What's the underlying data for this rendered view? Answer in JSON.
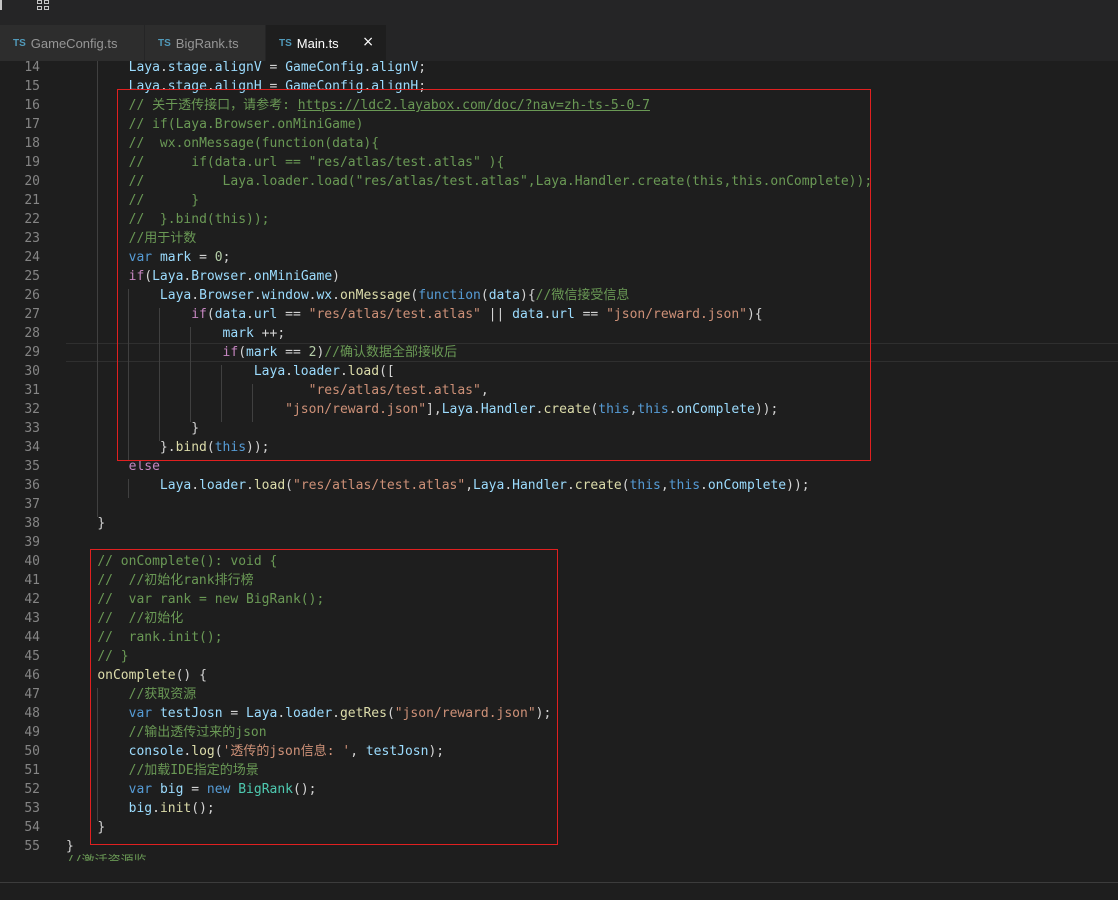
{
  "tabs": [
    {
      "badge": "TS",
      "name": "GameConfig.ts"
    },
    {
      "badge": "TS",
      "name": "BigRank.ts"
    },
    {
      "badge": "TS",
      "name": "Main.ts",
      "close": "×"
    }
  ],
  "lines": [
    {
      "n": "14",
      "t": [
        [
          "        ",
          ""
        ],
        [
          "Laya",
          "vr"
        ],
        [
          ".",
          ""
        ],
        [
          "stage",
          "vr"
        ],
        [
          ".",
          ""
        ],
        [
          "alignV",
          "vr"
        ],
        [
          " = ",
          ""
        ],
        [
          "GameConfig",
          "vr"
        ],
        [
          ".",
          ""
        ],
        [
          "alignV",
          "vr"
        ],
        [
          ";",
          ""
        ]
      ]
    },
    {
      "n": "15",
      "t": [
        [
          "        ",
          ""
        ],
        [
          "Laya",
          "vr"
        ],
        [
          ".",
          ""
        ],
        [
          "stage",
          "vr"
        ],
        [
          ".",
          ""
        ],
        [
          "alignH",
          "vr"
        ],
        [
          " = ",
          ""
        ],
        [
          "GameConfig",
          "vr"
        ],
        [
          ".",
          ""
        ],
        [
          "alignH",
          "vr"
        ],
        [
          ";",
          ""
        ]
      ]
    },
    {
      "n": "16",
      "t": [
        [
          "        ",
          ""
        ],
        [
          "// 关于透传接口，请参考: ",
          "com"
        ],
        [
          "https://ldc2.layabox.com/doc/?nav=zh-ts-5-0-7",
          "link"
        ]
      ]
    },
    {
      "n": "17",
      "t": [
        [
          "        ",
          ""
        ],
        [
          "// if(Laya.Browser.onMiniGame)",
          "com"
        ]
      ]
    },
    {
      "n": "18",
      "t": [
        [
          "        ",
          ""
        ],
        [
          "//  wx.onMessage(function(data){",
          "com"
        ]
      ]
    },
    {
      "n": "19",
      "t": [
        [
          "        ",
          ""
        ],
        [
          "//      if(data.url == \"res/atlas/test.atlas\" ){",
          "com"
        ]
      ]
    },
    {
      "n": "20",
      "t": [
        [
          "        ",
          ""
        ],
        [
          "//          Laya.loader.load(\"res/atlas/test.atlas\",Laya.Handler.create(this,this.onComplete));",
          "com"
        ]
      ]
    },
    {
      "n": "21",
      "t": [
        [
          "        ",
          ""
        ],
        [
          "//      }",
          "com"
        ]
      ]
    },
    {
      "n": "22",
      "t": [
        [
          "        ",
          ""
        ],
        [
          "//  }.bind(this));",
          "com"
        ]
      ]
    },
    {
      "n": "23",
      "t": [
        [
          "        ",
          ""
        ],
        [
          "//用于计数",
          "com"
        ]
      ]
    },
    {
      "n": "24",
      "t": [
        [
          "        ",
          ""
        ],
        [
          "var",
          "kw"
        ],
        [
          " ",
          ""
        ],
        [
          "mark",
          "vr"
        ],
        [
          " = ",
          ""
        ],
        [
          "0",
          "num"
        ],
        [
          ";",
          ""
        ]
      ]
    },
    {
      "n": "25",
      "t": [
        [
          "        ",
          ""
        ],
        [
          "if",
          "ctl"
        ],
        [
          "(",
          ""
        ],
        [
          "Laya",
          "vr"
        ],
        [
          ".",
          ""
        ],
        [
          "Browser",
          "vr"
        ],
        [
          ".",
          ""
        ],
        [
          "onMiniGame",
          "vr"
        ],
        [
          ")",
          ""
        ]
      ]
    },
    {
      "n": "26",
      "t": [
        [
          "            ",
          ""
        ],
        [
          "Laya",
          "vr"
        ],
        [
          ".",
          ""
        ],
        [
          "Browser",
          "vr"
        ],
        [
          ".",
          ""
        ],
        [
          "window",
          "vr"
        ],
        [
          ".",
          ""
        ],
        [
          "wx",
          "vr"
        ],
        [
          ".",
          ""
        ],
        [
          "onMessage",
          "fn"
        ],
        [
          "(",
          ""
        ],
        [
          "function",
          "kw"
        ],
        [
          "(",
          ""
        ],
        [
          "data",
          "vr"
        ],
        [
          "){",
          ""
        ],
        [
          "//微信接受信息",
          "com"
        ]
      ]
    },
    {
      "n": "27",
      "t": [
        [
          "                ",
          ""
        ],
        [
          "if",
          "ctl"
        ],
        [
          "(",
          ""
        ],
        [
          "data",
          "vr"
        ],
        [
          ".",
          ""
        ],
        [
          "url",
          "vr"
        ],
        [
          " == ",
          ""
        ],
        [
          "\"res/atlas/test.atlas\"",
          "str"
        ],
        [
          " || ",
          ""
        ],
        [
          "data",
          "vr"
        ],
        [
          ".",
          ""
        ],
        [
          "url",
          "vr"
        ],
        [
          " == ",
          ""
        ],
        [
          "\"json/reward.json\"",
          "str"
        ],
        [
          "){",
          ""
        ]
      ]
    },
    {
      "n": "28",
      "t": [
        [
          "                    ",
          ""
        ],
        [
          "mark",
          "vr"
        ],
        [
          " ++;",
          ""
        ]
      ]
    },
    {
      "n": "29",
      "t": [
        [
          "                    ",
          ""
        ],
        [
          "if",
          "ctl"
        ],
        [
          "(",
          ""
        ],
        [
          "mark",
          "vr"
        ],
        [
          " == ",
          ""
        ],
        [
          "2",
          "num"
        ],
        [
          ")",
          ""
        ],
        [
          "//确认数据全部接收后",
          "com"
        ]
      ]
    },
    {
      "n": "30",
      "t": [
        [
          "                        ",
          ""
        ],
        [
          "Laya",
          "vr"
        ],
        [
          ".",
          ""
        ],
        [
          "loader",
          "vr"
        ],
        [
          ".",
          ""
        ],
        [
          "load",
          "fn"
        ],
        [
          "([",
          ""
        ]
      ]
    },
    {
      "n": "31",
      "t": [
        [
          "                               ",
          ""
        ],
        [
          "\"res/atlas/test.atlas\"",
          "str"
        ],
        [
          ",",
          ""
        ]
      ]
    },
    {
      "n": "32",
      "t": [
        [
          "                            ",
          ""
        ],
        [
          "\"json/reward.json\"",
          "str"
        ],
        [
          "],",
          ""
        ],
        [
          "Laya",
          "vr"
        ],
        [
          ".",
          ""
        ],
        [
          "Handler",
          "vr"
        ],
        [
          ".",
          ""
        ],
        [
          "create",
          "fn"
        ],
        [
          "(",
          ""
        ],
        [
          "this",
          "kw"
        ],
        [
          ",",
          ""
        ],
        [
          "this",
          "kw"
        ],
        [
          ".",
          ""
        ],
        [
          "onComplete",
          "vr"
        ],
        [
          "));",
          ""
        ]
      ]
    },
    {
      "n": "33",
      "t": [
        [
          "                ",
          ""
        ],
        [
          "}",
          ""
        ]
      ]
    },
    {
      "n": "34",
      "t": [
        [
          "            ",
          ""
        ],
        [
          "}.",
          ""
        ],
        [
          "bind",
          "fn"
        ],
        [
          "(",
          ""
        ],
        [
          "this",
          "kw"
        ],
        [
          "));",
          ""
        ]
      ]
    },
    {
      "n": "35",
      "t": [
        [
          "        ",
          ""
        ],
        [
          "else",
          "ctl"
        ]
      ]
    },
    {
      "n": "36",
      "t": [
        [
          "            ",
          ""
        ],
        [
          "Laya",
          "vr"
        ],
        [
          ".",
          ""
        ],
        [
          "loader",
          "vr"
        ],
        [
          ".",
          ""
        ],
        [
          "load",
          "fn"
        ],
        [
          "(",
          ""
        ],
        [
          "\"res/atlas/test.atlas\"",
          "str"
        ],
        [
          ",",
          ""
        ],
        [
          "Laya",
          "vr"
        ],
        [
          ".",
          ""
        ],
        [
          "Handler",
          "vr"
        ],
        [
          ".",
          ""
        ],
        [
          "create",
          "fn"
        ],
        [
          "(",
          ""
        ],
        [
          "this",
          "kw"
        ],
        [
          ",",
          ""
        ],
        [
          "this",
          "kw"
        ],
        [
          ".",
          ""
        ],
        [
          "onComplete",
          "vr"
        ],
        [
          "));",
          ""
        ]
      ]
    },
    {
      "n": "37",
      "t": []
    },
    {
      "n": "38",
      "t": [
        [
          "    ",
          ""
        ],
        [
          "}",
          ""
        ]
      ]
    },
    {
      "n": "39",
      "t": []
    },
    {
      "n": "40",
      "t": [
        [
          "    ",
          ""
        ],
        [
          "// onComplete(): void {",
          "com"
        ]
      ]
    },
    {
      "n": "41",
      "t": [
        [
          "    ",
          ""
        ],
        [
          "//  //初始化rank排行榜",
          "com"
        ]
      ]
    },
    {
      "n": "42",
      "t": [
        [
          "    ",
          ""
        ],
        [
          "//  var rank = new BigRank();",
          "com"
        ]
      ]
    },
    {
      "n": "43",
      "t": [
        [
          "    ",
          ""
        ],
        [
          "//  //初始化",
          "com"
        ]
      ]
    },
    {
      "n": "44",
      "t": [
        [
          "    ",
          ""
        ],
        [
          "//  rank.init();",
          "com"
        ]
      ]
    },
    {
      "n": "45",
      "t": [
        [
          "    ",
          ""
        ],
        [
          "// }",
          "com"
        ]
      ]
    },
    {
      "n": "46",
      "t": [
        [
          "    ",
          ""
        ],
        [
          "onComplete",
          "fn"
        ],
        [
          "() {",
          ""
        ]
      ]
    },
    {
      "n": "47",
      "t": [
        [
          "        ",
          ""
        ],
        [
          "//获取资源",
          "com"
        ]
      ]
    },
    {
      "n": "48",
      "t": [
        [
          "        ",
          ""
        ],
        [
          "var",
          "kw"
        ],
        [
          " ",
          ""
        ],
        [
          "testJosn",
          "vr"
        ],
        [
          " = ",
          ""
        ],
        [
          "Laya",
          "vr"
        ],
        [
          ".",
          ""
        ],
        [
          "loader",
          "vr"
        ],
        [
          ".",
          ""
        ],
        [
          "getRes",
          "fn"
        ],
        [
          "(",
          ""
        ],
        [
          "\"json/reward.json\"",
          "str"
        ],
        [
          ");",
          ""
        ]
      ]
    },
    {
      "n": "49",
      "t": [
        [
          "        ",
          ""
        ],
        [
          "//输出透传过来的json",
          "com"
        ]
      ]
    },
    {
      "n": "50",
      "t": [
        [
          "        ",
          ""
        ],
        [
          "console",
          "vr"
        ],
        [
          ".",
          ""
        ],
        [
          "log",
          "fn"
        ],
        [
          "(",
          ""
        ],
        [
          "'透传的json信息: '",
          "str"
        ],
        [
          ", ",
          ""
        ],
        [
          "testJosn",
          "vr"
        ],
        [
          ");",
          ""
        ]
      ]
    },
    {
      "n": "51",
      "t": [
        [
          "        ",
          ""
        ],
        [
          "//加载IDE指定的场景",
          "com"
        ]
      ]
    },
    {
      "n": "52",
      "t": [
        [
          "        ",
          ""
        ],
        [
          "var",
          "kw"
        ],
        [
          " ",
          ""
        ],
        [
          "big",
          "vr"
        ],
        [
          " = ",
          ""
        ],
        [
          "new",
          "kw"
        ],
        [
          " ",
          ""
        ],
        [
          "BigRank",
          "cls"
        ],
        [
          "();",
          ""
        ]
      ]
    },
    {
      "n": "53",
      "t": [
        [
          "        ",
          ""
        ],
        [
          "big",
          "vr"
        ],
        [
          ".",
          ""
        ],
        [
          "init",
          "fn"
        ],
        [
          "();",
          ""
        ]
      ]
    },
    {
      "n": "54",
      "t": [
        [
          "    ",
          ""
        ],
        [
          "}",
          ""
        ]
      ]
    },
    {
      "n": "55",
      "t": [
        [
          "}",
          ""
        ]
      ]
    }
  ],
  "partial_line": "//激活资源监"
}
